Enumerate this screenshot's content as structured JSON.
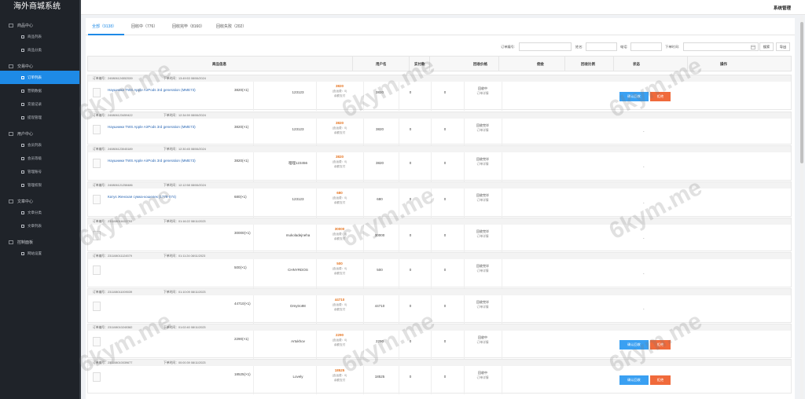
{
  "app_title": "海外商城系统",
  "header": {
    "sys_admin": "系统管理"
  },
  "sidebar": {
    "groups": [
      {
        "title": "商品中心",
        "items": [
          "商品列表",
          "商品分类"
        ]
      },
      {
        "title": "交易中心",
        "items": [
          "订单列表",
          "营销数据",
          "充值记录",
          "提现管理"
        ]
      },
      {
        "title": "用户中心",
        "items": [
          "会员列表",
          "会员等级",
          "管理账号",
          "管理权限"
        ]
      },
      {
        "title": "文章中心",
        "items": [
          "文章分类",
          "文章列表"
        ]
      },
      {
        "title": "控制面板",
        "items": [
          "网站设置"
        ]
      }
    ],
    "active_item": "订单列表"
  },
  "tabs": [
    {
      "label": "全部（9138）"
    },
    {
      "label": "回收中（776）"
    },
    {
      "label": "回收完毕（8160）"
    },
    {
      "label": "回收失败（202）"
    }
  ],
  "filter": {
    "order_no_label": "订单编号:",
    "name_label": "姓名:",
    "phone_label": "电话:",
    "time_label": "下单时间:",
    "search_btn": "搜索",
    "export_btn": "导出"
  },
  "table_headers": [
    "商品信息",
    "用户名",
    "实付款",
    "回收价格",
    "佣金",
    "回收比例",
    "状态",
    "操作"
  ],
  "common": {
    "price_sub1": "(含运费：0)",
    "price_sub2": "余额支付",
    "order_detail": "订单详情",
    "confirm_btn": "确认回收",
    "reject_btn": "拒绝",
    "dash": "-"
  },
  "orders": [
    {
      "order_no": "订单编号：240806124552539",
      "time": "下单时间：13:49:53 08/06/2024",
      "product": "Наушники TWS Apple AirPods 3rd generation (MME73)",
      "qty_price": "3820(×1)",
      "user": "123123",
      "amount": "3820",
      "paid": "3820",
      "recycle": "0",
      "commission": "0",
      "status": "回收中",
      "actions": true
    },
    {
      "order_no": "订单编号：240806123459422",
      "time": "下单时间：12:34:59 08/06/2024",
      "product": "Наушники TWS Apple AirPods 3rd generation (MME73)",
      "qty_price": "3820(×1)",
      "user": "123123",
      "amount": "3820",
      "paid": "3820",
      "recycle": "0",
      "commission": "0",
      "status": "回收完毕",
      "actions": false
    },
    {
      "order_no": "订单编号：240806123045189",
      "time": "下单时间：12:30:45 08/06/2024",
      "product": "Наушники TWS Apple AirPods 3rd generation (MME73)",
      "qty_price": "3820(×1)",
      "user": "哩哩123456",
      "amount": "3820",
      "paid": "3820",
      "recycle": "0",
      "commission": "0",
      "status": "回收完毕",
      "actions": false
    },
    {
      "order_no": "订单编号：240806121258486",
      "time": "下单时间：12:12:58 08/06/2024",
      "product": "Катуs Женская сумка-кошелек (1778-074)",
      "qty_price": "680(×1)",
      "user": "123123",
      "amount": "680",
      "paid": "680",
      "recycle": "0",
      "commission": "0",
      "status": "回收完毕",
      "actions": false
    },
    {
      "order_no": "订单编号：231108011622753",
      "time": "下单时间：01:16:22 08/11/2023",
      "product": "",
      "qty_price": "30000(×1)",
      "user": "mukoladejneha",
      "amount": "30000",
      "paid": "30000",
      "recycle": "0",
      "commission": "0",
      "status": "回收完毕",
      "actions": false
    },
    {
      "order_no": "订单编号：231108011124579",
      "time": "下单时间：01:11:24 08/11/2023",
      "product": "",
      "qty_price": "500(×1)",
      "user": "CHNYRDOS",
      "amount": "500",
      "paid": "500",
      "recycle": "0",
      "commission": "0",
      "status": "回收完毕",
      "actions": false
    },
    {
      "order_no": "订单编号：231108011009039",
      "time": "下单时间：01:10:09 08/11/2023",
      "product": "",
      "qty_price": "44710(×1)",
      "user": "Dmytro98",
      "amount": "44710",
      "paid": "44710",
      "recycle": "0",
      "commission": "0",
      "status": "回收完毕",
      "actions": false
    },
    {
      "order_no": "订单编号：231108010240382",
      "time": "下单时间：01:02:40 08/11/2023",
      "product": "",
      "qty_price": "2290(×1)",
      "user": "Artukhov",
      "amount": "2290",
      "paid": "2290",
      "recycle": "0",
      "commission": "0",
      "status": "回收中",
      "actions": true
    },
    {
      "order_no": "订单编号：231108010039677",
      "time": "下单时间：00:00:39 08/11/2023",
      "product": "",
      "qty_price": "18525(×1)",
      "user": "Lovely",
      "amount": "18525",
      "paid": "18525",
      "recycle": "0",
      "commission": "0",
      "status": "回收中",
      "actions": true
    }
  ],
  "colors": {
    "accent": "#1e8ae6",
    "sidebar": "#1f2329",
    "confirm": "#3aa0f2",
    "reject": "#f06a3b",
    "amount": "#e6731e"
  },
  "watermark": "6kym.me"
}
